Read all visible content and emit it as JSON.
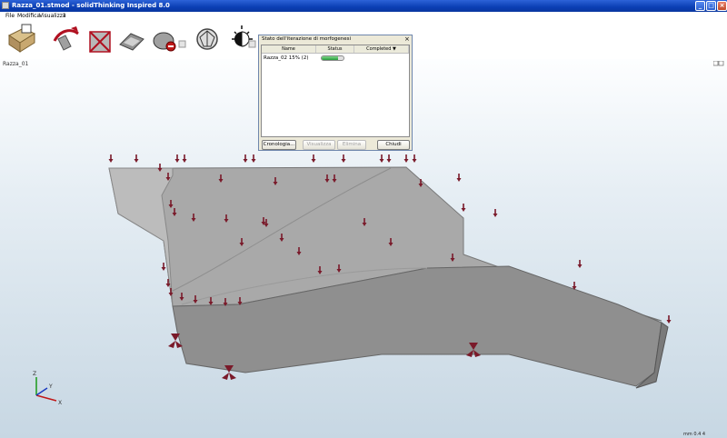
{
  "window": {
    "title": "Razza_01.stmod - solidThinking Inspired 8.0"
  },
  "menu": [
    "File",
    "Modifica",
    "Visualizza",
    "?"
  ],
  "toolbar": {
    "tools": [
      "new-model-icon",
      "extrude-icon",
      "morphogenesis-icon",
      "section-icon",
      "solid-block-icon",
      "run-analysis-icon",
      "small-square-icon",
      "symmetry-icon",
      "display-shading-icon",
      "small-square-icon"
    ]
  },
  "viewport": {
    "title": "Razza_01",
    "status_text": "mm 0.4 4"
  },
  "dialog": {
    "title": "Stato dell'iterazione di morfogenesi",
    "columns": [
      "Name",
      "Status",
      "Completed ▼"
    ],
    "rows": [
      {
        "name": "Razza_02 15% (2)",
        "progress": 0.75
      }
    ],
    "buttons": {
      "history": "Cronologia...",
      "view": "Visualizza",
      "delete": "Elimina",
      "close": "Chiudi"
    }
  },
  "axis": {
    "x": "X",
    "y": "Y",
    "z": "Z"
  },
  "colors": {
    "titlebar": "#0b3fb4",
    "load_arrow": "#7a1a2a",
    "model": "#a8a8a8"
  }
}
